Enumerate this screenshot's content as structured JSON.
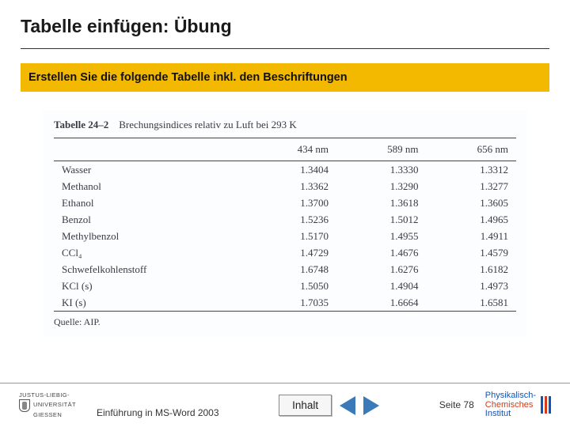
{
  "title": "Tabelle einfügen: Übung",
  "instruction": "Erstellen Sie die folgende Tabelle inkl. den Beschriftungen",
  "table_caption": {
    "number": "Tabelle 24–2",
    "text": "Brechungsindices relativ zu Luft bei 293 K"
  },
  "chart_data": {
    "type": "table",
    "title": "Brechungsindices relativ zu Luft bei 293 K",
    "columns": [
      "",
      "434 nm",
      "589 nm",
      "656 nm"
    ],
    "rows": [
      {
        "label": "Wasser",
        "values": [
          "1.3404",
          "1.3330",
          "1.3312"
        ]
      },
      {
        "label": "Methanol",
        "values": [
          "1.3362",
          "1.3290",
          "1.3277"
        ]
      },
      {
        "label": "Ethanol",
        "values": [
          "1.3700",
          "1.3618",
          "1.3605"
        ]
      },
      {
        "label": "Benzol",
        "values": [
          "1.5236",
          "1.5012",
          "1.4965"
        ]
      },
      {
        "label": "Methylbenzol",
        "values": [
          "1.5170",
          "1.4955",
          "1.4911"
        ]
      },
      {
        "label": "CCl₄",
        "values": [
          "1.4729",
          "1.4676",
          "1.4579"
        ]
      },
      {
        "label": "Schwefelkohlenstoff",
        "values": [
          "1.6748",
          "1.6276",
          "1.6182"
        ]
      },
      {
        "label": "KCl (s)",
        "values": [
          "1.5050",
          "1.4904",
          "1.4973"
        ]
      },
      {
        "label": "KI (s)",
        "values": [
          "1.7035",
          "1.6664",
          "1.6581"
        ]
      }
    ],
    "source": "Quelle: AIP."
  },
  "footer": {
    "university": {
      "line1": "JUSTUS-LIEBIG-",
      "line2a": "UNIVERSITÄT",
      "line2b": "GIESSEN"
    },
    "doc_title": "Einführung in MS-Word 2003",
    "inhalt_label": "Inhalt",
    "page_label": "Seite 78",
    "institute": {
      "line1": "Physikalisch-",
      "line2": "Chemisches",
      "line3": "Institut"
    }
  }
}
